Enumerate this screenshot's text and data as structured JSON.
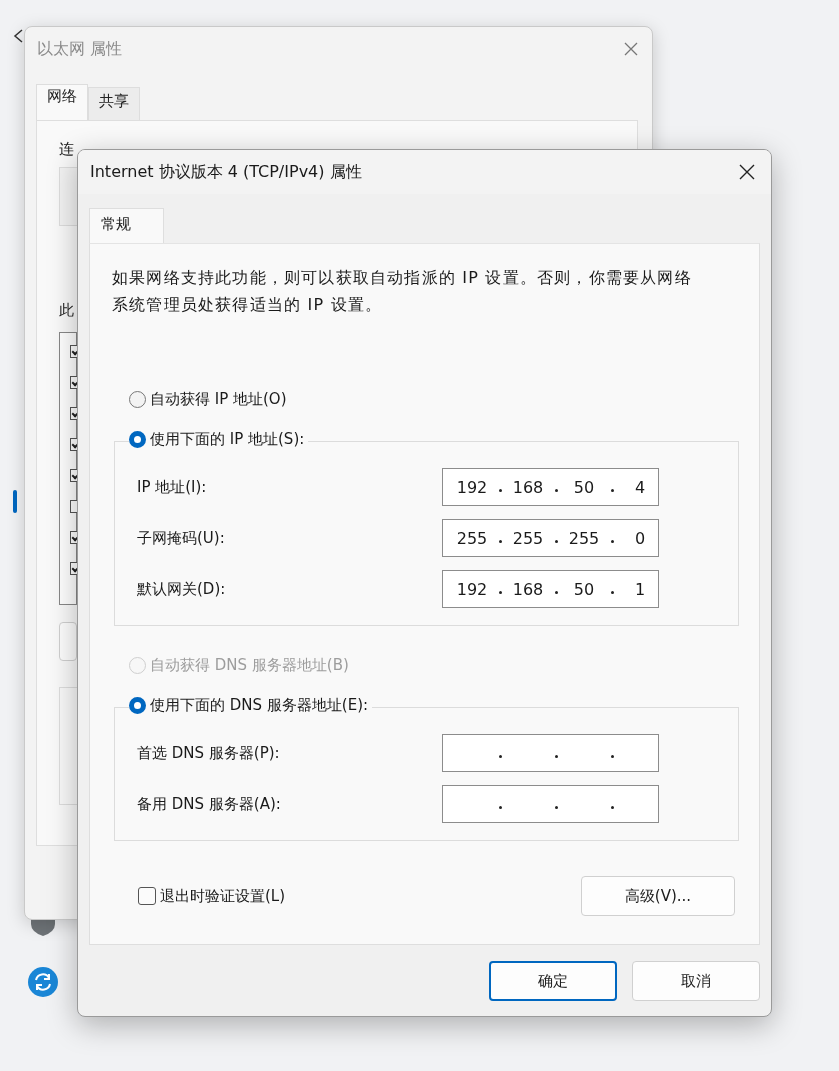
{
  "background_window": {
    "title": "以太网 属性",
    "tabs": [
      {
        "label": "网络",
        "selected": true
      },
      {
        "label": "共享",
        "selected": false
      }
    ],
    "labels": [
      "连",
      "此"
    ],
    "components": [
      {
        "checked": true
      },
      {
        "checked": true
      },
      {
        "checked": true
      },
      {
        "checked": true
      },
      {
        "checked": true
      },
      {
        "checked": false
      },
      {
        "checked": true
      },
      {
        "checked": true
      }
    ]
  },
  "dialog": {
    "title": "Internet 协议版本 4 (TCP/IPv4) 属性",
    "tabs": [
      {
        "label": "常规",
        "selected": true
      }
    ],
    "description": "如果网络支持此功能，则可以获取自动指派的 IP 设置。否则，你需要从网络系统管理员处获得适当的 IP 设置。",
    "ip_section": {
      "options": [
        {
          "label": "自动获得 IP 地址(O)",
          "selected": false,
          "disabled": false
        },
        {
          "label": "使用下面的 IP 地址(S):",
          "selected": true,
          "disabled": false
        }
      ],
      "fields": [
        {
          "label": "IP 地址(I):",
          "octets": [
            "192",
            "168",
            "50",
            "4"
          ]
        },
        {
          "label": "子网掩码(U):",
          "octets": [
            "255",
            "255",
            "255",
            "0"
          ]
        },
        {
          "label": "默认网关(D):",
          "octets": [
            "192",
            "168",
            "50",
            "1"
          ]
        }
      ]
    },
    "dns_section": {
      "options": [
        {
          "label": "自动获得 DNS 服务器地址(B)",
          "selected": false,
          "disabled": true
        },
        {
          "label": "使用下面的 DNS 服务器地址(E):",
          "selected": true,
          "disabled": false
        }
      ],
      "fields": [
        {
          "label": "首选 DNS 服务器(P):"
        },
        {
          "label": "备用 DNS 服务器(A):"
        }
      ]
    },
    "validate_checkbox": {
      "label": "退出时验证设置(L)",
      "checked": false
    },
    "advanced_button": "高级(V)...",
    "buttons": [
      {
        "label": "确定",
        "default": true
      },
      {
        "label": "取消",
        "default": false
      }
    ]
  }
}
